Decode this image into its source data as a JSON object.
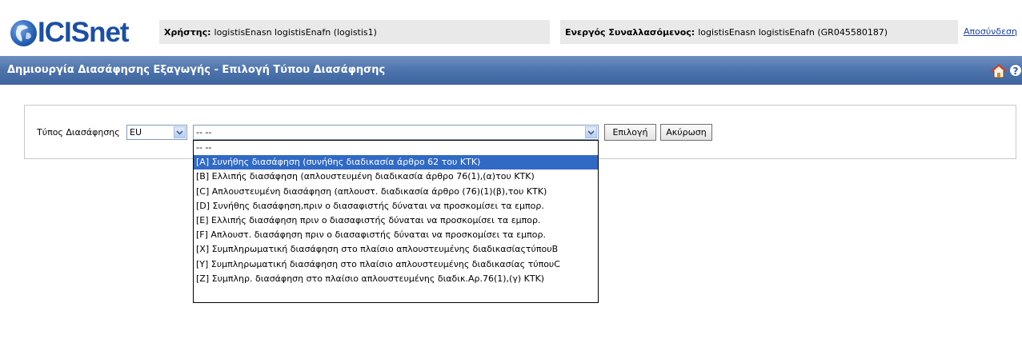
{
  "header": {
    "logo_text": "ICISnet",
    "user_label": "Χρήστης:",
    "user_value": "logistisEnasn logistisEnafn (logistis1)",
    "trader_label": "Ενεργός Συναλλασόμενος:",
    "trader_value": "logistisEnasn logistisEnafn (GR045580187)",
    "logout_link": "Αποσύνδεση"
  },
  "titlebar": {
    "title": "Δημιουργία Διασάφησης Εξαγωγής - Επιλογή Τύπου Διασάφησης",
    "help_symbol": "?"
  },
  "form": {
    "type_label": "Τύπος Διασάφησης",
    "eu_select_value": "EU",
    "type_select_value": "-- --",
    "select_button": "Επιλογή",
    "cancel_button": "Ακύρωση"
  },
  "dropdown": {
    "selected_index": 1,
    "options": [
      "-- --",
      "[A] Συνήθης διασάφηση (συνήθης διαδικασία άρθρο 62 του ΚΤΚ)",
      "[B] Ελλιπής διασάφηση (απλουστευμένη διαδικασία άρθρο 76(1),(α)του ΚΤΚ)",
      "[C] Απλουστευμένη διασάφηση (απλουστ. διαδικασία άρθρο (76)(1)(β),του ΚΤΚ)",
      "[D] Συνήθης διασάφηση,πριν ο διασαφιστής δύναται να προσκομίσει τα εμπορ.",
      "[E] Ελλιπής διασάφηση πριν ο διασαφιστής δύναται να προσκομίσει τα εμπορ.",
      "[F] Απλουστ. διασάφηση πριν ο διασαφιστής δύναται να προσκομίσει τα εμπορ.",
      "[X] Συμπληρωματική διασάφηση στο πλαίσιο απλουστευμένης διαδικασίαςτύπουB",
      "[Y] Συμπληρωματική διασάφηση στο πλαίσιο απλουστευμένης διαδικασίας τύπουC",
      "[Z] Συμπληρ. διασάφηση στο πλαίσιο απλουστευμένης διαδικ.Αρ.76(1),(γ) ΚΤΚ)"
    ]
  },
  "icons": {
    "logo": "globe-logo-icon",
    "home": "home-icon",
    "help": "help-icon",
    "dropdown_arrow": "chevron-down-icon"
  },
  "colors": {
    "titlebar": "#4d73ad",
    "info_box": "#e9e9e9",
    "selection": "#316ac5",
    "logo_text": "#1b4fa3"
  }
}
